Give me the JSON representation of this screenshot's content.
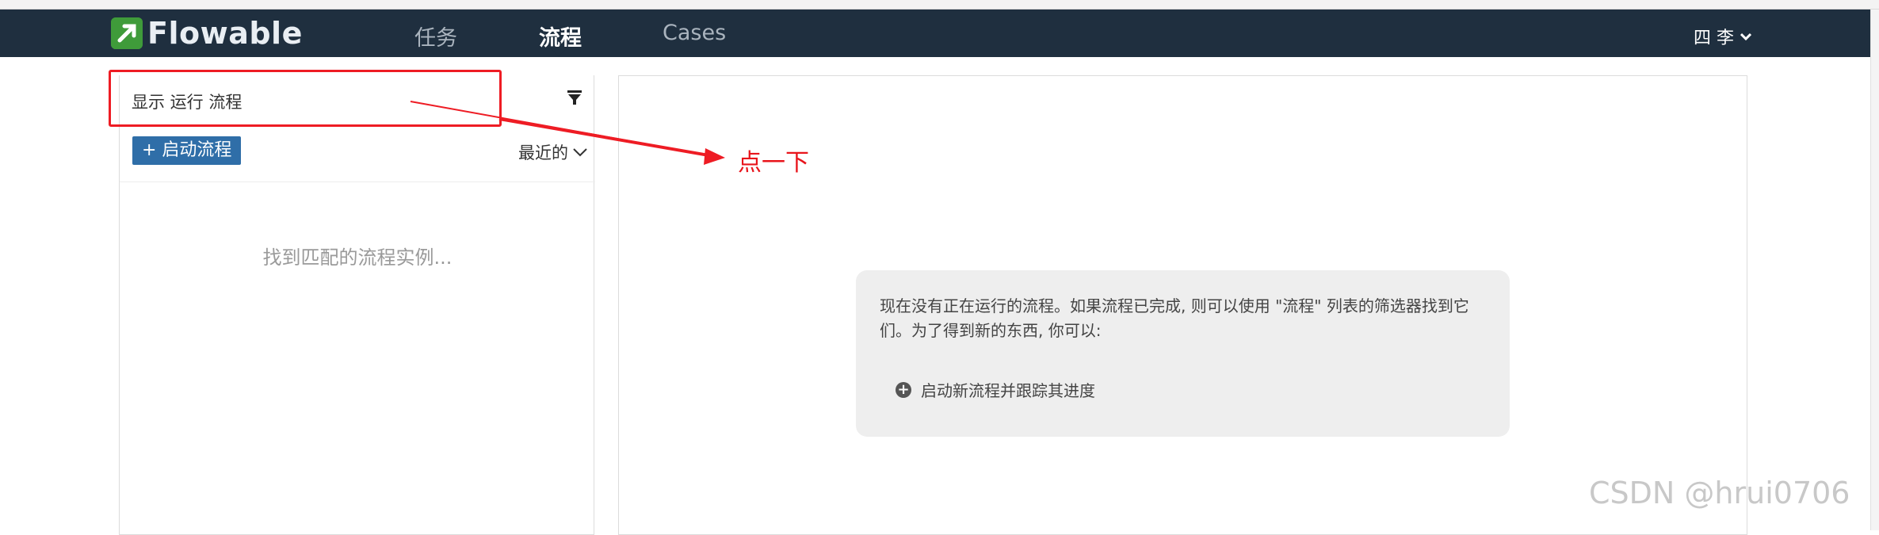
{
  "app": {
    "logo_text": "Flowable",
    "brand_color": "#3f9b3a",
    "navbar_color": "#1f2f3f"
  },
  "nav": {
    "items": [
      {
        "label": "任务"
      },
      {
        "label": "流程"
      },
      {
        "label": "Cases"
      }
    ],
    "active": "流程",
    "user_label": "四 李"
  },
  "left_panel": {
    "filter_label": "显示 运行 流程",
    "filter_icon": "filter-icon",
    "start_button_label": "+ 启动流程",
    "sort_label": "最近的",
    "empty_message": "找到匹配的流程实例..."
  },
  "right_panel": {
    "info_text": "现在没有正在运行的流程。如果流程已完成, 则可以使用 \"流程\" 列表的筛选器找到它们。为了得到新的东西, 你可以:",
    "action_label": "启动新流程并跟踪其进度"
  },
  "annotation": {
    "text": "点一下",
    "color": "#ee1c24"
  },
  "watermark": "CSDN @hrui0706"
}
